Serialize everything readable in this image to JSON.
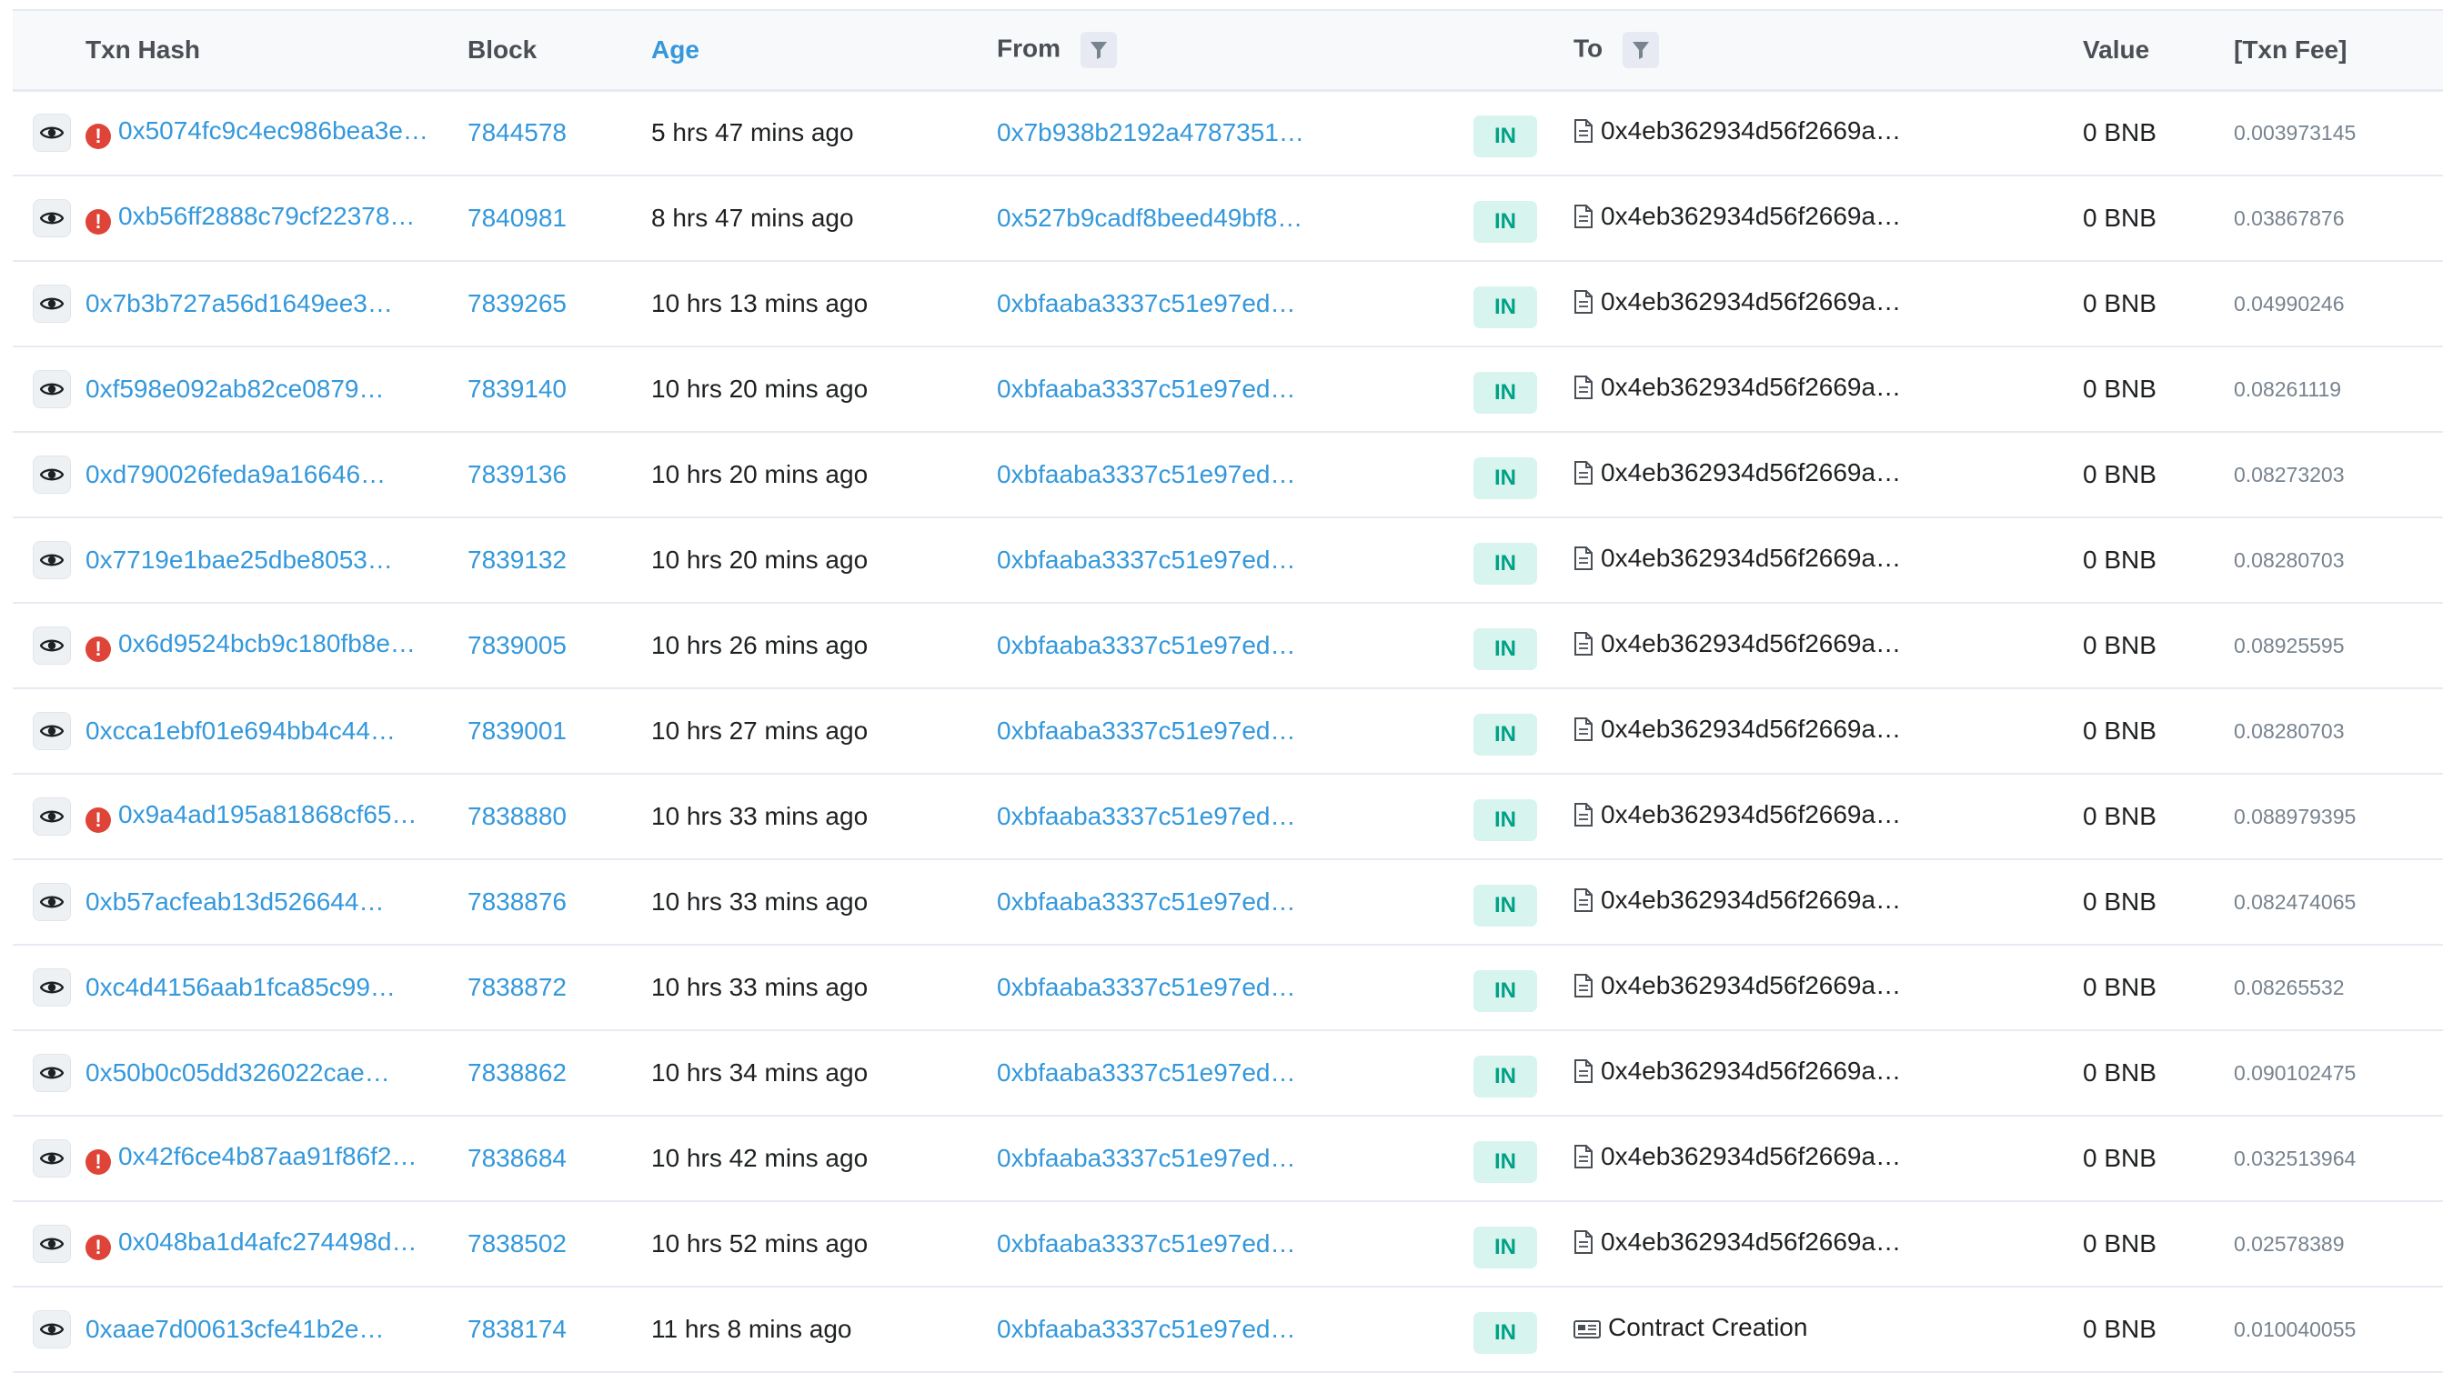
{
  "headers": {
    "txn_hash": "Txn Hash",
    "block": "Block",
    "age": "Age",
    "from": "From",
    "to": "To",
    "value": "Value",
    "txn_fee": "[Txn Fee]"
  },
  "direction_label": "IN",
  "colors": {
    "link": "#3498db",
    "error": "#de4437",
    "badge_bg": "#d8f4ee",
    "badge_text": "#00a186"
  },
  "icons": {
    "view": "eye-icon",
    "error": "exclamation-circle-icon",
    "filter": "funnel-filter-icon",
    "contract": "document-icon",
    "contract_creation": "newspaper-icon"
  },
  "rows": [
    {
      "hash": "0x5074fc9c4ec986bea3e…",
      "error": true,
      "block": "7844578",
      "age": "5 hrs 47 mins ago",
      "from": "0x7b938b2192a4787351…",
      "to": "0x4eb362934d56f2669a…",
      "value": "0 BNB",
      "fee": "0.003973145"
    },
    {
      "hash": "0xb56ff2888c79cf22378…",
      "error": true,
      "block": "7840981",
      "age": "8 hrs 47 mins ago",
      "from": "0x527b9cadf8beed49bf8…",
      "to": "0x4eb362934d56f2669a…",
      "value": "0 BNB",
      "fee": "0.03867876"
    },
    {
      "hash": "0x7b3b727a56d1649ee3…",
      "error": false,
      "block": "7839265",
      "age": "10 hrs 13 mins ago",
      "from": "0xbfaaba3337c51e97ed…",
      "to": "0x4eb362934d56f2669a…",
      "value": "0 BNB",
      "fee": "0.04990246"
    },
    {
      "hash": "0xf598e092ab82ce0879…",
      "error": false,
      "block": "7839140",
      "age": "10 hrs 20 mins ago",
      "from": "0xbfaaba3337c51e97ed…",
      "to": "0x4eb362934d56f2669a…",
      "value": "0 BNB",
      "fee": "0.08261119"
    },
    {
      "hash": "0xd790026feda9a16646…",
      "error": false,
      "block": "7839136",
      "age": "10 hrs 20 mins ago",
      "from": "0xbfaaba3337c51e97ed…",
      "to": "0x4eb362934d56f2669a…",
      "value": "0 BNB",
      "fee": "0.08273203"
    },
    {
      "hash": "0x7719e1bae25dbe8053…",
      "error": false,
      "block": "7839132",
      "age": "10 hrs 20 mins ago",
      "from": "0xbfaaba3337c51e97ed…",
      "to": "0x4eb362934d56f2669a…",
      "value": "0 BNB",
      "fee": "0.08280703"
    },
    {
      "hash": "0x6d9524bcb9c180fb8e…",
      "error": true,
      "block": "7839005",
      "age": "10 hrs 26 mins ago",
      "from": "0xbfaaba3337c51e97ed…",
      "to": "0x4eb362934d56f2669a…",
      "value": "0 BNB",
      "fee": "0.08925595"
    },
    {
      "hash": "0xcca1ebf01e694bb4c44…",
      "error": false,
      "block": "7839001",
      "age": "10 hrs 27 mins ago",
      "from": "0xbfaaba3337c51e97ed…",
      "to": "0x4eb362934d56f2669a…",
      "value": "0 BNB",
      "fee": "0.08280703"
    },
    {
      "hash": "0x9a4ad195a81868cf65…",
      "error": true,
      "block": "7838880",
      "age": "10 hrs 33 mins ago",
      "from": "0xbfaaba3337c51e97ed…",
      "to": "0x4eb362934d56f2669a…",
      "value": "0 BNB",
      "fee": "0.088979395"
    },
    {
      "hash": "0xb57acfeab13d526644…",
      "error": false,
      "block": "7838876",
      "age": "10 hrs 33 mins ago",
      "from": "0xbfaaba3337c51e97ed…",
      "to": "0x4eb362934d56f2669a…",
      "value": "0 BNB",
      "fee": "0.082474065"
    },
    {
      "hash": "0xc4d4156aab1fca85c99…",
      "error": false,
      "block": "7838872",
      "age": "10 hrs 33 mins ago",
      "from": "0xbfaaba3337c51e97ed…",
      "to": "0x4eb362934d56f2669a…",
      "value": "0 BNB",
      "fee": "0.08265532"
    },
    {
      "hash": "0x50b0c05dd326022cae…",
      "error": false,
      "block": "7838862",
      "age": "10 hrs 34 mins ago",
      "from": "0xbfaaba3337c51e97ed…",
      "to": "0x4eb362934d56f2669a…",
      "value": "0 BNB",
      "fee": "0.090102475"
    },
    {
      "hash": "0x42f6ce4b87aa91f86f2…",
      "error": true,
      "block": "7838684",
      "age": "10 hrs 42 mins ago",
      "from": "0xbfaaba3337c51e97ed…",
      "to": "0x4eb362934d56f2669a…",
      "value": "0 BNB",
      "fee": "0.032513964"
    },
    {
      "hash": "0x048ba1d4afc274498d…",
      "error": true,
      "block": "7838502",
      "age": "10 hrs 52 mins ago",
      "from": "0xbfaaba3337c51e97ed…",
      "to": "0x4eb362934d56f2669a…",
      "value": "0 BNB",
      "fee": "0.02578389"
    },
    {
      "hash": "0xaae7d00613cfe41b2e…",
      "error": false,
      "block": "7838174",
      "age": "11 hrs 8 mins ago",
      "from": "0xbfaaba3337c51e97ed…",
      "to": "Contract Creation",
      "to_is_creation": true,
      "value": "0 BNB",
      "fee": "0.010040055"
    }
  ]
}
